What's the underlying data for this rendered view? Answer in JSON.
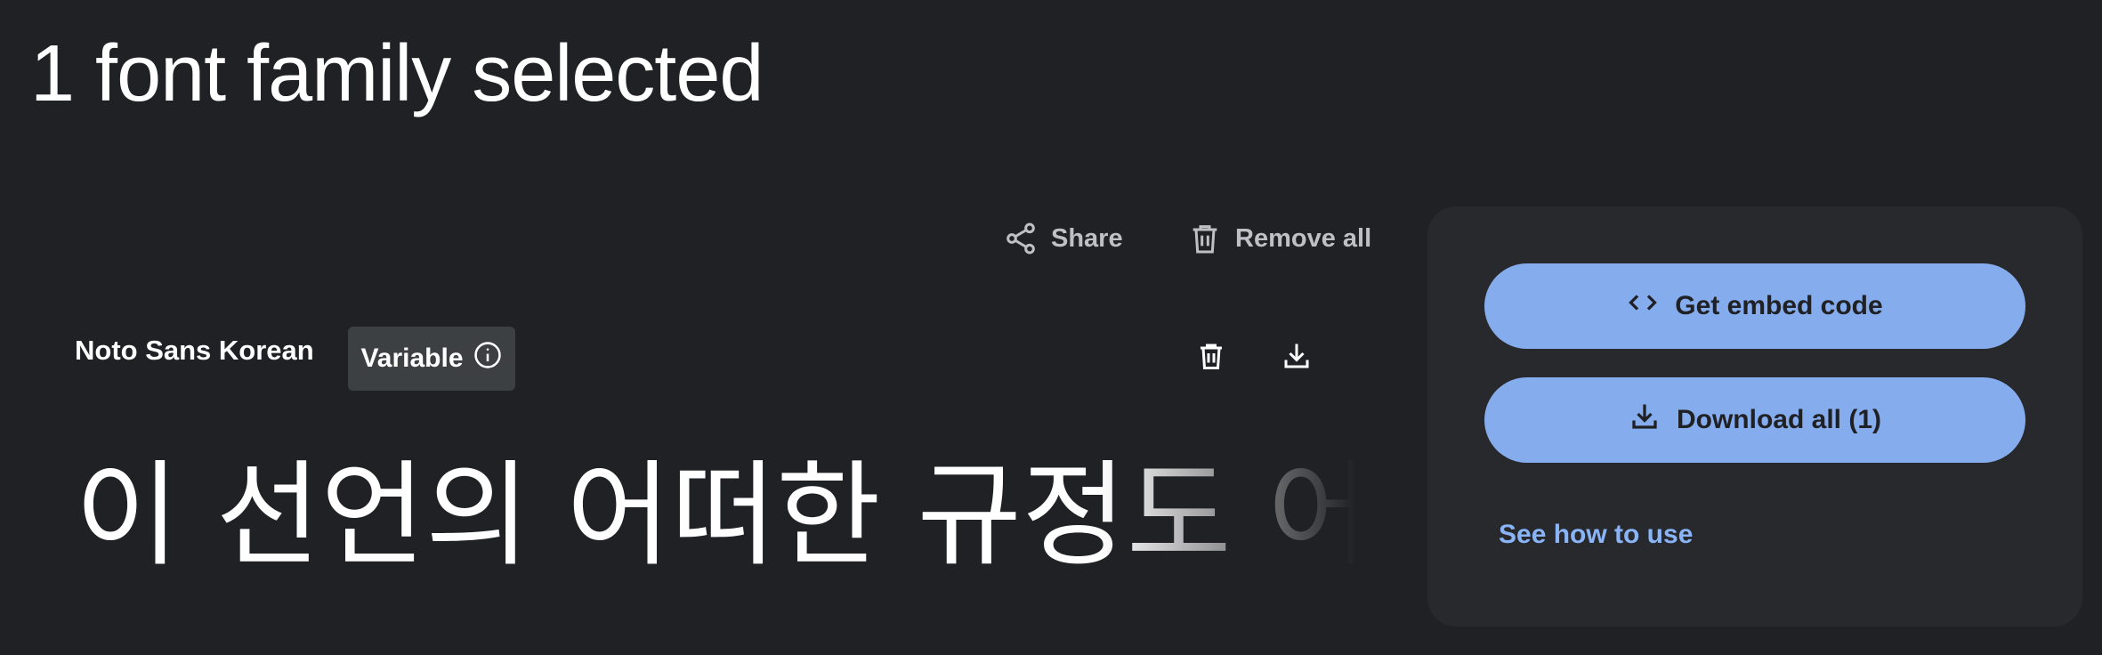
{
  "header": {
    "title": "1 font family selected"
  },
  "toolbar": {
    "share_label": "Share",
    "remove_all_label": "Remove all",
    "share_icon": "share-icon",
    "remove_icon": "trash-icon"
  },
  "family": {
    "name": "Noto Sans Korean",
    "chip_label": "Variable",
    "chip_icon": "info-icon",
    "delete_icon": "trash-icon",
    "download_icon": "download-icon",
    "preview_text": "이 선언의 어떠한 규정도 어떤 국가"
  },
  "panel": {
    "embed_label": "Get embed code",
    "embed_icon": "code-icon",
    "download_label": "Download all (1)",
    "download_icon": "download-icon",
    "see_how_label": "See how to use"
  },
  "colors": {
    "background": "#202124",
    "panel": "#28292c",
    "accent": "#8ab4f8",
    "chip": "#3c4043"
  }
}
